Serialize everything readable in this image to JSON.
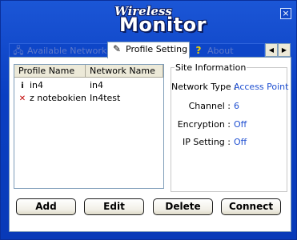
{
  "window": {
    "logo_top": "Wireless",
    "logo_main": "Monitor",
    "close_glyph": "×"
  },
  "tabs": [
    {
      "label": "Available Networks",
      "icon": "network-icon",
      "state": "inactive"
    },
    {
      "label": "Profile Setting",
      "icon": "pencil-icon",
      "state": "active"
    },
    {
      "label": "About",
      "icon": "help-icon",
      "state": "inactive"
    }
  ],
  "tab_scroll": {
    "left": "◀",
    "right": "▶"
  },
  "profiles": {
    "headers": [
      "Profile Name",
      "Network Name"
    ],
    "rows": [
      {
        "profile": "in4",
        "network": "in4",
        "icon": "info-icon"
      },
      {
        "profile": "z notebokiem",
        "network": "In4test",
        "icon": "disconnected-icon"
      }
    ]
  },
  "site_info": {
    "legend": "Site Information",
    "fields": [
      {
        "label": "Network Type :",
        "value": "Access Point"
      },
      {
        "label": "Channel :",
        "value": "6"
      },
      {
        "label": "Encryption :",
        "value": "Off"
      },
      {
        "label": "IP Setting :",
        "value": "Off"
      }
    ]
  },
  "buttons": {
    "add": "Add",
    "edit": "Edit",
    "delete": "Delete",
    "connect": "Connect"
  },
  "colors": {
    "frame_blue": "#0a3fc2",
    "value_blue": "#1f4fd1"
  }
}
